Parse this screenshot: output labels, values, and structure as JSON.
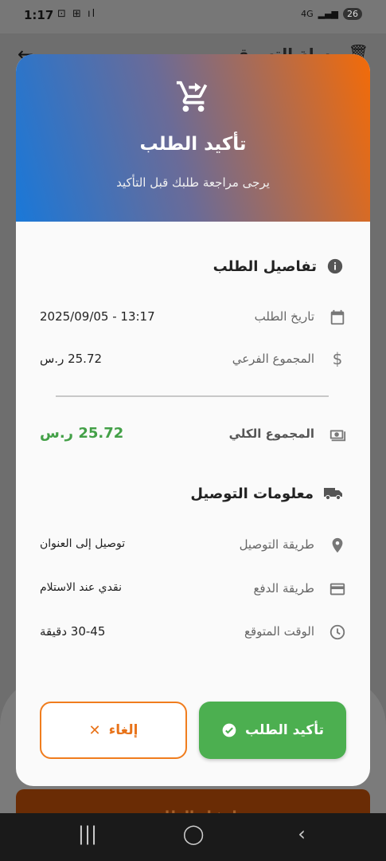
{
  "status_bar": {
    "time": "1:17",
    "network": "4G",
    "battery": "26"
  },
  "background": {
    "title": "سلة التسوق",
    "bottom_button": "إنشاء الطلب"
  },
  "dialog": {
    "title": "تأكيد الطلب",
    "subtitle": "يرجى مراجعة طلبك قبل التأكيد",
    "order_details": {
      "title": "تفاصيل الطلب",
      "date_label": "تاريخ الطلب",
      "date_value": "2025/09/05 - 13:17",
      "subtotal_label": "المجموع الفرعي",
      "subtotal_value": "25.72 ر.س",
      "total_label": "المجموع الكلي",
      "total_value": "25.72 ر.س"
    },
    "delivery_info": {
      "title": "معلومات التوصيل",
      "method_label": "طريقة التوصيل",
      "method_value": "توصيل إلى العنوان",
      "payment_label": "طريقة الدفع",
      "payment_value": "نقدي عند الاستلام",
      "time_label": "الوقت المتوقع",
      "time_value": "30-45 دقيقة"
    },
    "buttons": {
      "confirm": "تأكيد الطلب",
      "cancel": "إلغاء"
    }
  },
  "colors": {
    "header_gradient_start": "#1a78d8",
    "header_gradient_end": "#f36b08",
    "confirm_green": "#4caf50",
    "total_green": "#43a047",
    "cancel_orange": "#f07d1e"
  }
}
